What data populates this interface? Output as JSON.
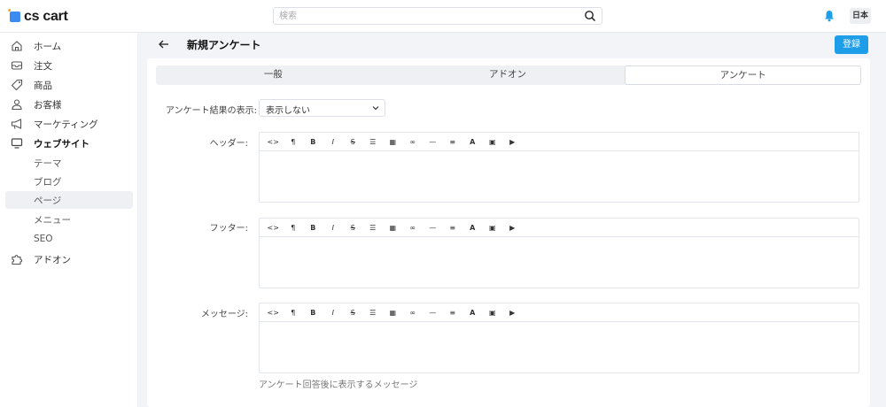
{
  "app": {
    "logo_text": "cs cart",
    "brand_color": "#3a8cf0",
    "lang": "日本"
  },
  "search": {
    "placeholder": "検索",
    "value": ""
  },
  "sidebar": {
    "items": [
      {
        "label": "ホーム",
        "icon": "home-icon"
      },
      {
        "label": "注文",
        "icon": "inbox-icon"
      },
      {
        "label": "商品",
        "icon": "tag-icon"
      },
      {
        "label": "お客様",
        "icon": "user-icon"
      },
      {
        "label": "マーケティング",
        "icon": "megaphone-icon"
      },
      {
        "label": "ウェブサイト",
        "icon": "monitor-icon"
      },
      {
        "label": "アドオン",
        "icon": "puzzle-icon"
      }
    ],
    "website_sub": [
      {
        "label": "テーマ"
      },
      {
        "label": "ブログ"
      },
      {
        "label": "ページ"
      },
      {
        "label": "メニュー"
      },
      {
        "label": "SEO"
      }
    ],
    "active_item": "ウェブサイト",
    "active_sub": "ページ"
  },
  "header": {
    "title": "新規アンケート",
    "save_label": "登録",
    "save_color": "#1e9ee8"
  },
  "tabs": [
    {
      "label": "一般"
    },
    {
      "label": "アドオン"
    },
    {
      "label": "アンケート"
    }
  ],
  "active_tab": "アンケート",
  "form": {
    "result_display_label": "アンケート結果の表示:",
    "result_display_value": "表示しない",
    "header_label": "ヘッダー:",
    "footer_label": "フッター:",
    "message_label": "メッセージ:",
    "message_hint": "アンケート回答後に表示するメッセージ"
  },
  "editor_toolbar": [
    {
      "icon": "code-icon",
      "glyph": "<>"
    },
    {
      "icon": "paragraph-icon",
      "glyph": "¶"
    },
    {
      "icon": "bold-icon",
      "glyph": "B"
    },
    {
      "icon": "italic-icon",
      "glyph": "I"
    },
    {
      "icon": "strikethrough-icon",
      "glyph": "S"
    },
    {
      "icon": "list-icon",
      "glyph": "☰"
    },
    {
      "icon": "table-icon",
      "glyph": "▦"
    },
    {
      "icon": "link-icon",
      "glyph": "∞"
    },
    {
      "icon": "horizontal-rule-icon",
      "glyph": "—"
    },
    {
      "icon": "align-icon",
      "glyph": "≡"
    },
    {
      "icon": "font-color-icon",
      "glyph": "A"
    },
    {
      "icon": "image-icon",
      "glyph": "▣"
    },
    {
      "icon": "video-icon",
      "glyph": "▶"
    }
  ]
}
